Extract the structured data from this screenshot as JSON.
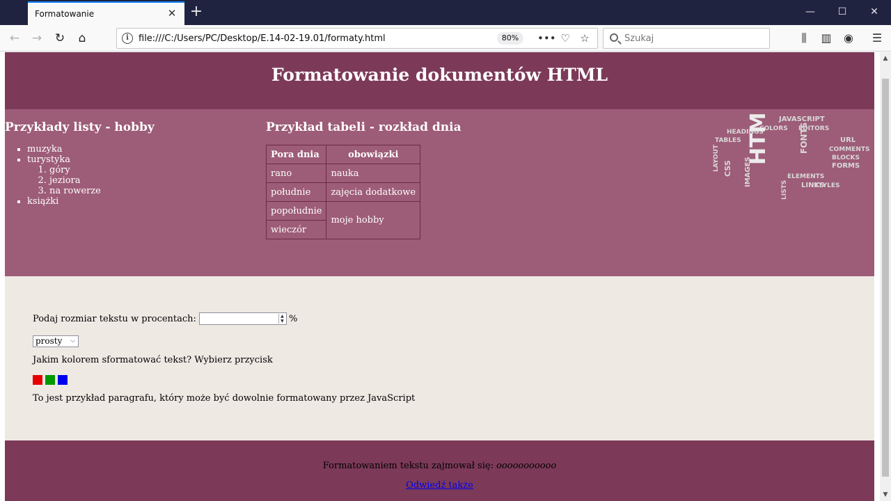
{
  "browser": {
    "tab_title": "Formatowanie",
    "url": "file:///C:/Users/PC/Desktop/E.14-02-19.01/formaty.html",
    "zoom": "80%",
    "search_placeholder": "Szukaj"
  },
  "page": {
    "title": "Formatowanie dokumentów HTML",
    "list_heading": "Przykłady listy - hobby",
    "hobbies": [
      "muzyka",
      "turystyka",
      "książki"
    ],
    "tourism_sub": [
      "góry",
      "jeziora",
      "na rowerze"
    ],
    "table_heading": "Przykład tabeli - rozkład dnia",
    "table": {
      "headers": [
        "Pora dnia",
        "obowiązki"
      ],
      "rows": [
        [
          "rano",
          "nauka"
        ],
        [
          "południe",
          "zajęcia dodatkowe"
        ],
        [
          "popołudnie",
          "moje hobby"
        ],
        [
          "wieczór",
          ""
        ]
      ]
    },
    "tag_cloud_words": [
      "JAVASCRIPT",
      "HEADINGS",
      "COLORS",
      "EDITORS",
      "TABLES",
      "HTML",
      "IMAGES",
      "LAYOUT",
      "FORMS",
      "LINKS",
      "LISTS",
      "ELEMENTS",
      "COMMENTS",
      "BLOCKS",
      "FONTS",
      "URL",
      "CSS",
      "STYLES"
    ],
    "form": {
      "size_label": "Podaj rozmiar tekstu w procentach:",
      "size_value": "",
      "size_unit": "%",
      "font_style_selected": "prosty",
      "color_prompt": "Jakim kolorem sformatować tekst? Wybierz przycisk",
      "colors": [
        "#e60000",
        "#009900",
        "#0000ee"
      ]
    },
    "demo_paragraph": "To jest przykład paragrafu, który może być dowolnie formatowany przez JavaScript",
    "footer": {
      "author_label": "Formatowaniem tekstu zajmował się:",
      "author_name": "ooooooooooo",
      "link_text": "Odwiedź także"
    }
  },
  "colors": {
    "header_bg": "#7c3a58",
    "mid_bg": "#9d5c77",
    "form_bg": "#efe9e4"
  }
}
